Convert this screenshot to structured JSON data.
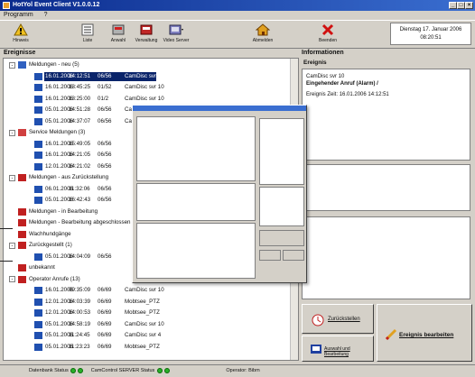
{
  "app": {
    "title": "HotYol Event Client V1.0.0.12"
  },
  "menu": [
    "Programm",
    "?"
  ],
  "toolbar": {
    "buttons": [
      {
        "label": "Hinweis",
        "icon": "warning-icon"
      },
      {
        "label": "Liste",
        "icon": "list-icon"
      },
      {
        "label": "Anwahl",
        "icon": "dial-icon"
      },
      {
        "label": "Verwaltung",
        "icon": "manage-icon"
      },
      {
        "label": "Video Server",
        "icon": "video-server-icon"
      },
      {
        "label": "Abmelden",
        "icon": "logout-icon"
      },
      {
        "label": "Beenden",
        "icon": "exit-icon"
      }
    ],
    "date_line1": "Dienstag 17. Januar 2006",
    "date_line2": "08:20:51"
  },
  "events": {
    "title": "Ereignisse",
    "rows": [
      {
        "kind": "group",
        "label": "Meldungen - neu (5)",
        "level": 0,
        "expander": "-"
      },
      {
        "kind": "item",
        "date": "16.01.2006",
        "time": "14:12:51",
        "code": "06/56",
        "name": "CamDisc svr 10",
        "selected": true
      },
      {
        "kind": "item",
        "date": "16.01.2006",
        "time": "13:45:25",
        "code": "01/52",
        "name": "CamDisc svr 10"
      },
      {
        "kind": "item",
        "date": "16.01.2006",
        "time": "13:25:00",
        "code": "01/2",
        "name": "CamDisc svr 10"
      },
      {
        "kind": "item",
        "date": "05.01.2006",
        "time": "14:51:28",
        "code": "06/56",
        "name": "CamDisc svr 10"
      },
      {
        "kind": "item",
        "date": "05.01.2006",
        "time": "14:37:07",
        "code": "06/56",
        "name": "CamDisc svr 10"
      },
      {
        "kind": "group",
        "label": "Service Meldungen (3)",
        "level": 0,
        "expander": "-"
      },
      {
        "kind": "item",
        "date": "16.01.2006",
        "time": "15:49:05",
        "code": "06/56",
        "name": ""
      },
      {
        "kind": "item",
        "date": "16.01.2006",
        "time": "14:21:05",
        "code": "06/56",
        "name": ""
      },
      {
        "kind": "item",
        "date": "12.01.2006",
        "time": "14:21:02",
        "code": "06/56",
        "name": ""
      },
      {
        "kind": "group",
        "label": "Meldungen - aus Zurückstellung",
        "level": 0,
        "expander": "-"
      },
      {
        "kind": "item",
        "date": "06.01.2006",
        "time": "11:32:06",
        "code": "06/56",
        "name": ""
      },
      {
        "kind": "item",
        "date": "05.01.2006",
        "time": "16:42:43",
        "code": "06/56",
        "name": ""
      },
      {
        "kind": "group",
        "label": "Meldungen - in Bearbeitung",
        "level": 0,
        "expander": ""
      },
      {
        "kind": "group",
        "label": "Meldungen - Bearbeitung abgeschlossen",
        "level": 0,
        "expander": ""
      },
      {
        "kind": "group",
        "label": "Wachhundgänge",
        "level": 0,
        "expander": ""
      },
      {
        "kind": "group",
        "label": "Zurückgestellt (1)",
        "level": 0,
        "expander": "-"
      },
      {
        "kind": "item",
        "date": "05.01.2006",
        "time": "14:04:09",
        "code": "06/56",
        "name": ""
      },
      {
        "kind": "group",
        "label": "unbekannt",
        "level": 0,
        "expander": ""
      },
      {
        "kind": "group",
        "label": "Operator Anrufe (13)",
        "level": 0,
        "expander": "-"
      },
      {
        "kind": "item",
        "date": "16.01.2006",
        "time": "09:35:09",
        "code": "06/69",
        "name": "CamDisc svr 10"
      },
      {
        "kind": "item",
        "date": "12.01.2006",
        "time": "14:03:39",
        "code": "06/69",
        "name": "Mobtsee_PTZ"
      },
      {
        "kind": "item",
        "date": "12.01.2006",
        "time": "14:00:53",
        "code": "06/69",
        "name": "Mobtsee_PTZ"
      },
      {
        "kind": "item",
        "date": "05.01.2006",
        "time": "14:58:19",
        "code": "06/69",
        "name": "CamDisc svr 10"
      },
      {
        "kind": "item",
        "date": "05.01.2006",
        "time": "11:24:45",
        "code": "06/69",
        "name": "CamDisc svr 4"
      },
      {
        "kind": "item",
        "date": "05.01.2006",
        "time": "11:23:23",
        "code": "06/69",
        "name": "Mobtsee_PTZ"
      }
    ]
  },
  "info": {
    "title": "Informationen",
    "section": "Ereignis",
    "line1": "CamDisc svr 10",
    "line2": "Eingehender Anruf (Alarm) /",
    "line3_label": "Ereignis Zeit:",
    "line3_date": "16.01.2006",
    "line3_time": "14:12:51"
  },
  "actions": {
    "postpone": "Zurückstellen",
    "select_edit": "Auswahl und Bearbeitung",
    "edit_event": "Ereignis bearbeiten"
  },
  "status": {
    "db_label": "Datenbank Status",
    "cc_label": "CamControl SERVER Status",
    "operator_label": "Operator:",
    "operator": "Bibm"
  },
  "colors": {
    "title_from": "#0a2a8c",
    "title_to": "#3a6ed0",
    "selection": "#0a246a",
    "status_ok": "#28b028"
  }
}
